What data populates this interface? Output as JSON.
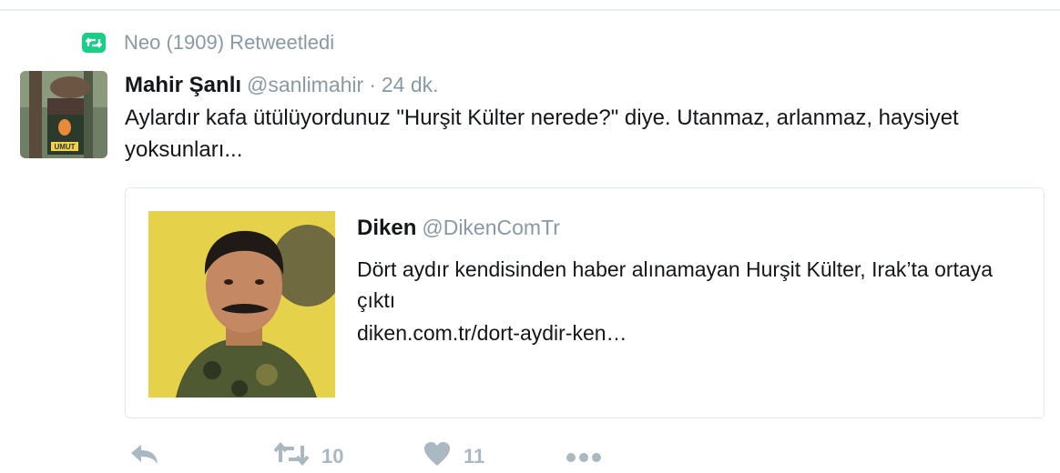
{
  "context": {
    "icon": "retweet-icon",
    "text": "Neo (1909) Retweetledi",
    "accent": "#19cf86"
  },
  "tweet": {
    "avatar_icon": "user-avatar",
    "name": "Mahir Şanlı",
    "handle": "@sanlimahir",
    "separator": "·",
    "time": "24 dk.",
    "text": "Aylardır kafa ütülüyordunuz \"Hurşit Külter nerede?\" diye. Utanmaz, arlanmaz, haysiyet yoksunları..."
  },
  "quote": {
    "thumbnail_icon": "person-photo",
    "name": "Diken",
    "handle": "@DikenComTr",
    "text": "Dört aydır kendisinden haber alınamayan Hurşit Külter, Irak’ta ortaya çıktı",
    "link": "diken.com.tr/dort-aydir-ken…"
  },
  "actions": {
    "reply_icon": "reply-icon",
    "retweet_icon": "retweet-icon",
    "retweet_count": "10",
    "like_icon": "heart-icon",
    "like_count": "11",
    "more_icon": "more-icon",
    "icon_color": "#aab8c2"
  }
}
